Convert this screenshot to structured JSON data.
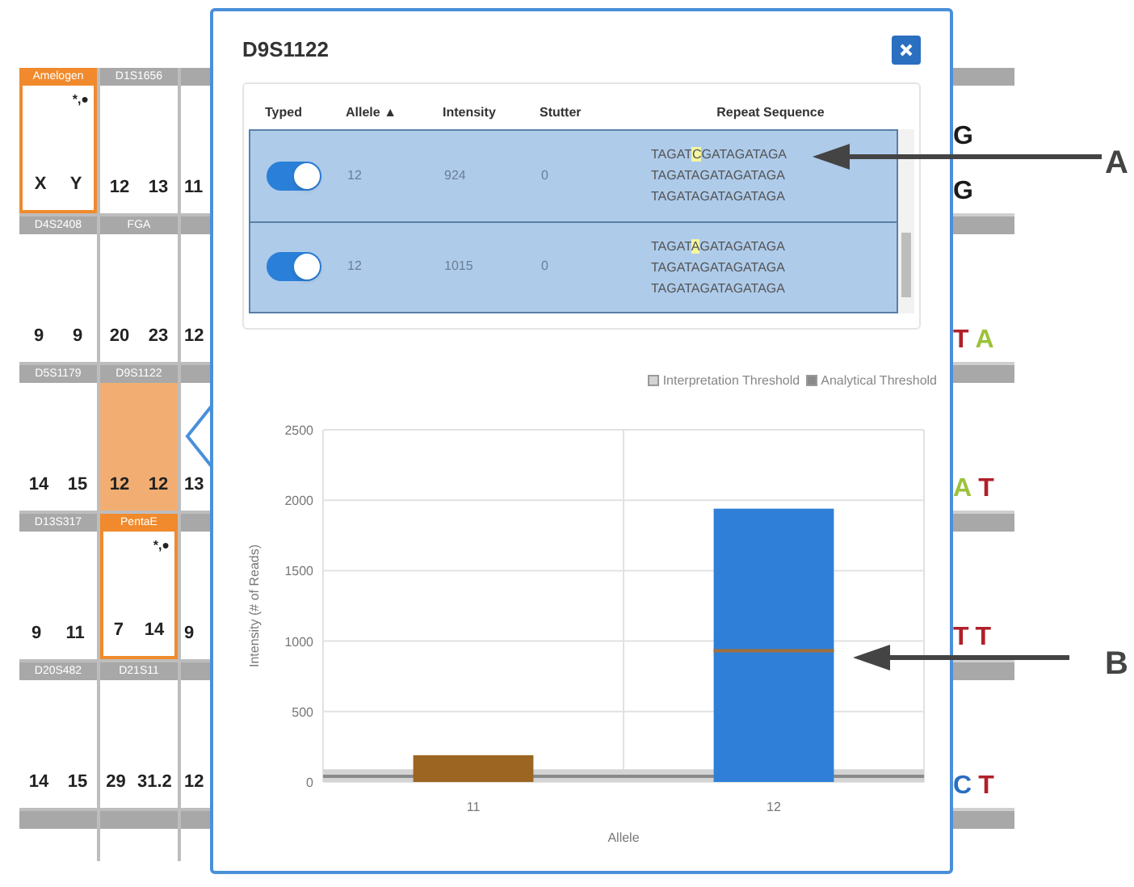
{
  "grid": {
    "rows": [
      {
        "cells": [
          {
            "header": "Amelogen",
            "values": [
              "X",
              "Y"
            ],
            "flagged": true,
            "selected": false,
            "flag": "*,●"
          },
          {
            "header": "D1S1656",
            "values": [
              "12",
              "13"
            ],
            "flagged": false,
            "selected": false
          },
          {
            "values": [
              "11"
            ],
            "flagged": false,
            "selected": false
          }
        ]
      },
      {
        "cells": [
          {
            "header": "D4S2408",
            "values": [
              "9",
              "9"
            ],
            "flagged": false,
            "selected": false
          },
          {
            "header": "FGA",
            "values": [
              "20",
              "23"
            ],
            "flagged": false,
            "selected": false
          },
          {
            "values": [
              "12"
            ],
            "flagged": false,
            "selected": false
          }
        ]
      },
      {
        "cells": [
          {
            "header": "D5S1179",
            "values": [
              "14",
              "15"
            ],
            "flagged": false,
            "selected": false
          },
          {
            "header": "D9S1122",
            "values": [
              "12",
              "12"
            ],
            "flagged": false,
            "selected": true
          },
          {
            "values": [
              "13"
            ],
            "flagged": false,
            "selected": false
          }
        ]
      },
      {
        "cells": [
          {
            "header": "D13S317",
            "values": [
              "9",
              "11"
            ],
            "flagged": false,
            "selected": false
          },
          {
            "header": "PentaE",
            "values": [
              "7",
              "14"
            ],
            "flagged": true,
            "selected": false,
            "flag": "*,●"
          },
          {
            "values": [
              "9"
            ],
            "flagged": false,
            "selected": false
          }
        ]
      },
      {
        "cells": [
          {
            "header": "D20S482",
            "values": [
              "14",
              "15"
            ],
            "flagged": false,
            "selected": false
          },
          {
            "header": "D21S11",
            "values": [
              "29",
              "31.2"
            ],
            "flagged": false,
            "selected": false
          },
          {
            "values": [
              "12"
            ],
            "flagged": false,
            "selected": false
          }
        ]
      }
    ]
  },
  "right_column": [
    {
      "lines": [
        [
          {
            "letter": "G",
            "color": "#1a1a1a"
          }
        ],
        [
          {
            "letter": "G",
            "color": "#1a1a1a"
          }
        ]
      ]
    },
    {
      "lines": [
        [
          {
            "letter": "T",
            "color": "#b0202a"
          },
          {
            "letter": "A",
            "color": "#9cc23a"
          }
        ]
      ]
    },
    {
      "lines": [
        [
          {
            "letter": "A",
            "color": "#9cc23a"
          },
          {
            "letter": "T",
            "color": "#b0202a"
          }
        ]
      ]
    },
    {
      "lines": [
        [
          {
            "letter": "T",
            "color": "#b0202a"
          },
          {
            "letter": "T",
            "color": "#b0202a"
          }
        ]
      ]
    },
    {
      "lines": [
        [
          {
            "letter": "C",
            "color": "#2a6fc0"
          },
          {
            "letter": "T",
            "color": "#b0202a"
          }
        ]
      ]
    }
  ],
  "popup": {
    "title": "D9S1122",
    "table": {
      "columns": [
        {
          "label": "Typed"
        },
        {
          "label": "Allele ▲"
        },
        {
          "label": "Intensity"
        },
        {
          "label": "Stutter"
        },
        {
          "label": "Repeat Sequence"
        }
      ],
      "rows": [
        {
          "typed": true,
          "selected": true,
          "allele": "12",
          "intensity": "924",
          "stutter": "0",
          "sequence": [
            {
              "before": "TAGAT",
              "highlight": "C",
              "after": "GATAGATAGA"
            },
            {
              "before": "TAGATAGATAGATAGA"
            },
            {
              "before": "TAGATAGATAGATAGA"
            }
          ]
        },
        {
          "typed": true,
          "selected": true,
          "allele": "12",
          "intensity": "1015",
          "stutter": "0",
          "sequence": [
            {
              "before": "TAGAT",
              "highlight": "A",
              "after": "GATAGATAGA"
            },
            {
              "before": "TAGATAGATAGATAGA"
            },
            {
              "before": "TAGATAGATAGATAGA"
            }
          ]
        }
      ]
    },
    "legend": [
      {
        "label": "Interpretation Threshold",
        "color": "#d4d4d4"
      },
      {
        "label": "Analytical Threshold",
        "color": "#8a8a8a"
      }
    ],
    "chart_data": {
      "type": "bar",
      "xlabel": "Allele",
      "ylabel": "Intensity (# of Reads)",
      "categories": [
        "11",
        "12"
      ],
      "series": [
        {
          "color": "#9c6522",
          "values": [
            190,
            null
          ]
        },
        {
          "color": "#2f7fd8",
          "values": [
            null,
            1940
          ]
        }
      ],
      "bands": [
        {
          "axis": "y",
          "from": 0,
          "to": 90,
          "color": "#d4d4d4"
        }
      ],
      "ref_lines": [
        {
          "axis": "y",
          "value": 40,
          "color": "#8a8a8a"
        }
      ],
      "grid": true,
      "ylim": [
        0,
        2500
      ],
      "yticks": [
        0,
        500,
        1000,
        1500,
        2000,
        2500
      ]
    }
  },
  "callouts": [
    {
      "label": "A"
    },
    {
      "label": "B"
    }
  ]
}
